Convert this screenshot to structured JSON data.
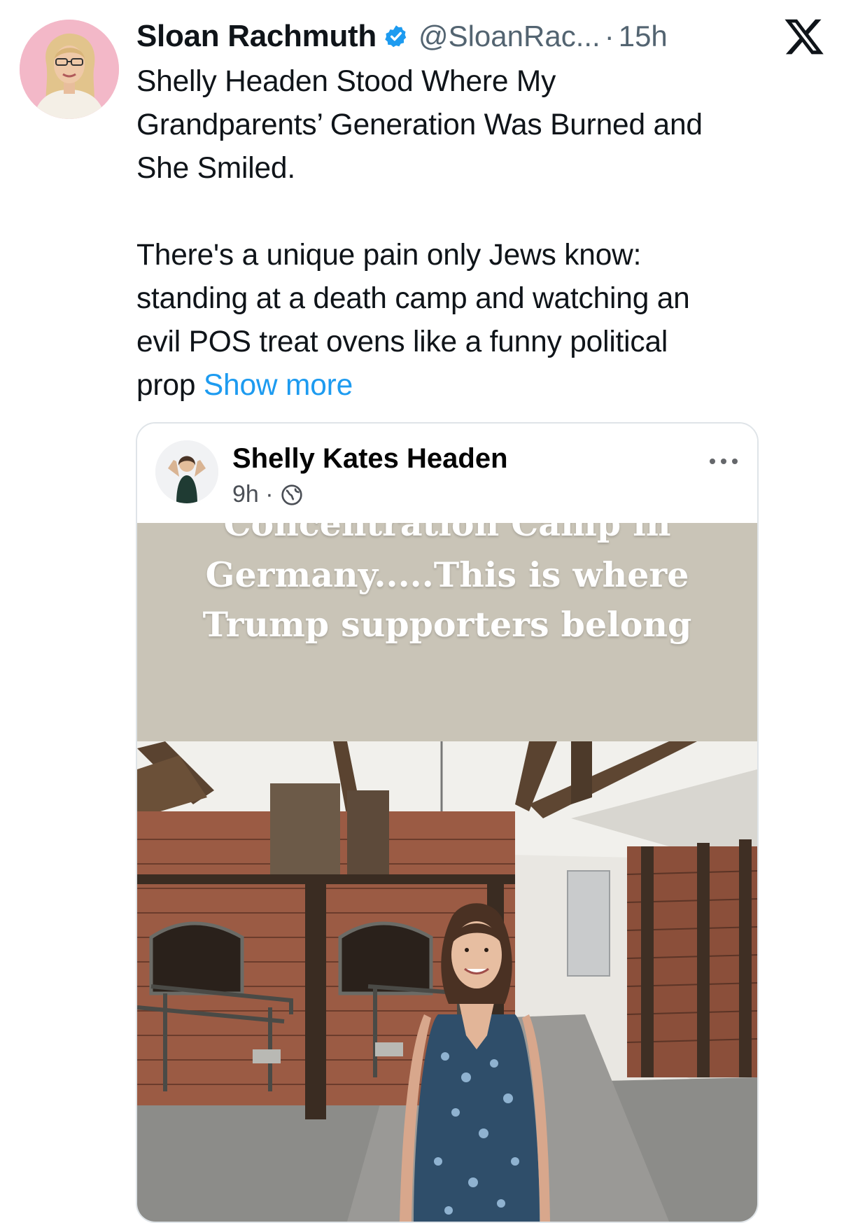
{
  "tweet": {
    "author_name": "Sloan Rachmuth",
    "handle": "@SloanRac...",
    "separator": "·",
    "time": "15h",
    "text": "Shelly Headen Stood Where My\nGrandparents’ Generation Was Burned and\nShe Smiled.\n\nThere's a unique pain only Jews know:\nstanding at a death camp and watching an\nevil POS treat ovens like a funny political\nprop ",
    "show_more": "Show more"
  },
  "icons": {
    "verified": "verified-badge-icon",
    "platform": "x-logo-icon",
    "privacy": "globe-icon",
    "menu": "more-dots-icon"
  },
  "embedded_post": {
    "author_name": "Shelly Kates Headen",
    "time": "9h ·",
    "caption_lines": [
      "Concentration Camp in",
      "Germany.....This is where",
      "Trump supporters belong"
    ]
  },
  "colors": {
    "link": "#1d9bf0",
    "verified": "#1d9bf0",
    "secondary_text": "#536471",
    "caption_bg": "#c9c4b7",
    "avatar_bg": "#f3b8c8"
  }
}
